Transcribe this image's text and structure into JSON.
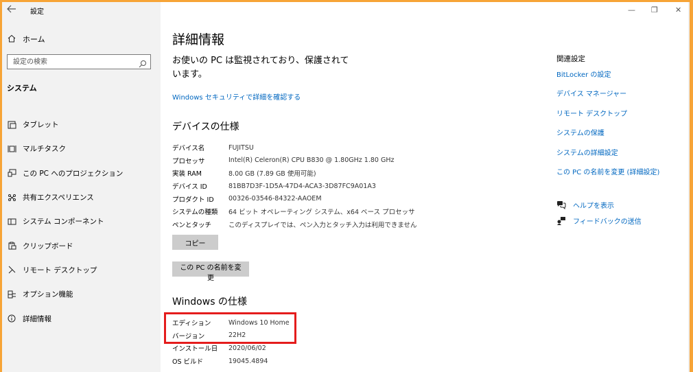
{
  "window": {
    "title": "設定",
    "controls": {
      "minimize": "—",
      "maximize": "❐",
      "close": "✕"
    }
  },
  "sidebar": {
    "home_label": "ホーム",
    "search_placeholder": "設定の検索",
    "section_title": "システム",
    "items": [
      {
        "label": "タブレット",
        "icon": "tablet-icon"
      },
      {
        "label": "マルチタスク",
        "icon": "multitask-icon"
      },
      {
        "label": "この PC へのプロジェクション",
        "icon": "projection-icon"
      },
      {
        "label": "共有エクスペリエンス",
        "icon": "share-icon"
      },
      {
        "label": "システム コンポーネント",
        "icon": "component-icon"
      },
      {
        "label": "クリップボード",
        "icon": "clipboard-icon"
      },
      {
        "label": "リモート デスクトップ",
        "icon": "remote-desktop-icon"
      },
      {
        "label": "オプション機能",
        "icon": "optional-features-icon"
      },
      {
        "label": "詳細情報",
        "icon": "info-icon"
      }
    ]
  },
  "main": {
    "page_title": "詳細情報",
    "protect_message": "お使いの PC は監視されており、保護されています。",
    "security_link": "Windows セキュリティで詳細を確認する",
    "device_spec_title": "デバイスの仕様",
    "device_specs": [
      {
        "key": "デバイス名",
        "value": "FUJITSU"
      },
      {
        "key": "プロセッサ",
        "value": "Intel(R) Celeron(R) CPU B830 @ 1.80GHz   1.80 GHz"
      },
      {
        "key": "実装 RAM",
        "value": "8.00 GB (7.89 GB 使用可能)"
      },
      {
        "key": "デバイス ID",
        "value": "81BB7D3F-1D5A-47D4-ACA3-3D87FC9A01A3"
      },
      {
        "key": "プロダクト ID",
        "value": "00326-03546-84322-AAOEM"
      },
      {
        "key": "システムの種類",
        "value": "64 ビット オペレーティング システム、x64 ベース プロセッサ"
      },
      {
        "key": "ペンとタッチ",
        "value": "このディスプレイでは、ペン入力とタッチ入力は利用できません"
      }
    ],
    "copy_button": "コピー",
    "rename_button": "この PC の名前を変更",
    "windows_spec_title": "Windows の仕様",
    "windows_specs": [
      {
        "key": "エディション",
        "value": "Windows 10 Home"
      },
      {
        "key": "バージョン",
        "value": "22H2"
      },
      {
        "key": "インストール日",
        "value": "2020/06/02"
      },
      {
        "key": "OS ビルド",
        "value": "19045.4894"
      }
    ],
    "highlight_color": "#e41c1c"
  },
  "related": {
    "title": "関連設定",
    "links": [
      "BitLocker の設定",
      "デバイス マネージャー",
      "リモート デスクトップ",
      "システムの保護",
      "システムの詳細設定",
      "この PC の名前を変更 (詳細設定)"
    ],
    "help": {
      "label": "ヘルプを表示",
      "icon": "help-chat-icon"
    },
    "feedback": {
      "label": "フィードバックの送信",
      "icon": "feedback-icon"
    }
  },
  "colors": {
    "accent": "#0067c0",
    "frame": "#f7a437",
    "sidebar_bg": "#f2f2f2"
  }
}
